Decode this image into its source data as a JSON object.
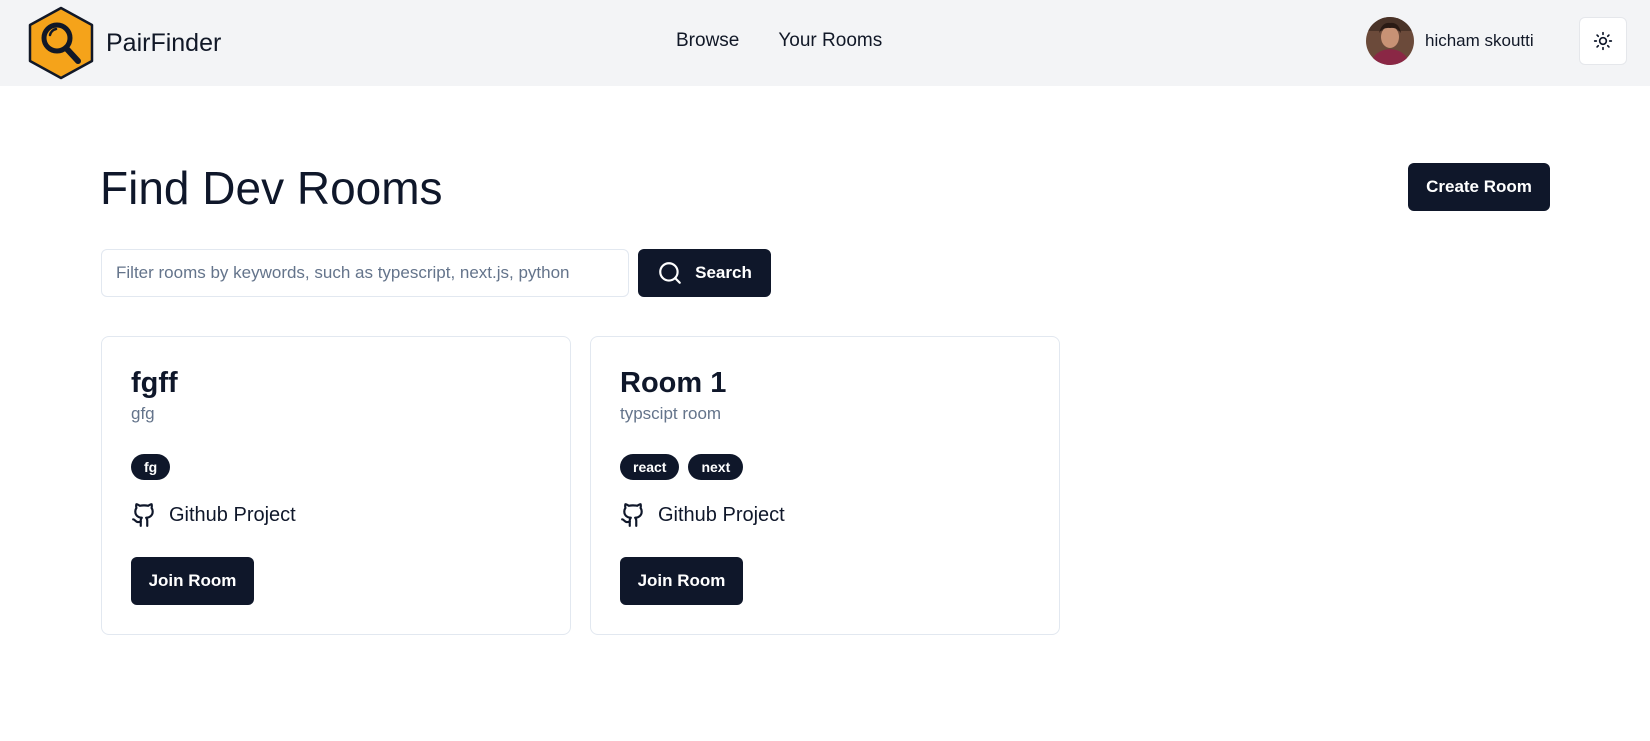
{
  "header": {
    "brand": "PairFinder",
    "logo_icon": "magnifier-hexagon-logo",
    "nav": [
      {
        "label": "Browse"
      },
      {
        "label": "Your Rooms"
      }
    ],
    "user": {
      "name": "hicham skoutti"
    },
    "theme_icon": "sun-icon"
  },
  "main": {
    "title": "Find Dev Rooms",
    "create_label": "Create Room",
    "search": {
      "placeholder": "Filter rooms by keywords, such as typescript, next.js, python",
      "value": "",
      "button_label": "Search"
    },
    "rooms": [
      {
        "title": "fgff",
        "description": "gfg",
        "tags": [
          "fg"
        ],
        "github_label": "Github Project",
        "join_label": "Join Room"
      },
      {
        "title": "Room 1",
        "description": "typscipt room",
        "tags": [
          "react",
          "next"
        ],
        "github_label": "Github Project",
        "join_label": "Join Room"
      }
    ]
  },
  "colors": {
    "primary": "#0f172a",
    "header_bg": "#f3f4f6",
    "logo_orange": "#f5a31a",
    "muted_text": "#64748b",
    "border": "#e2e8f0"
  }
}
